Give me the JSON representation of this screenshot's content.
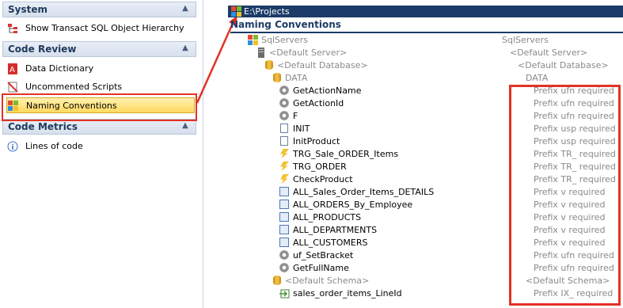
{
  "sidebar": {
    "sections": [
      {
        "title": "System",
        "items": [
          {
            "label": "Show Transact SQL Object Hierarchy",
            "icon": "hierarchy-icon"
          }
        ]
      },
      {
        "title": "Code Review",
        "items": [
          {
            "label": "Data Dictionary",
            "icon": "data-dictionary-icon"
          },
          {
            "label": "Uncommented Scripts",
            "icon": "uncommented-scripts-icon"
          },
          {
            "label": "Naming Conventions",
            "icon": "naming-conventions-icon"
          }
        ]
      },
      {
        "title": "Code Metrics",
        "items": [
          {
            "label": "Lines of code",
            "icon": "info-icon"
          }
        ]
      }
    ],
    "selected": "Naming Conventions"
  },
  "main": {
    "path": "E:\\Projects",
    "heading": "Naming Conventions",
    "tree": [
      {
        "name": "SqlServers",
        "value": "SqlServers"
      },
      {
        "name": "<Default Server>",
        "value": "<Default Server>"
      },
      {
        "name": "<Default Database>",
        "value": "<Default Database>"
      },
      {
        "name": "DATA",
        "value": "DATA"
      },
      {
        "name": "GetActionName",
        "value": "Prefix ufn required"
      },
      {
        "name": "GetActionId",
        "value": "Prefix ufn required"
      },
      {
        "name": "F",
        "value": "Prefix ufn required"
      },
      {
        "name": "INIT",
        "value": "Prefix usp required"
      },
      {
        "name": "InitProduct",
        "value": "Prefix usp required"
      },
      {
        "name": "TRG_Sale_ORDER_Items",
        "value": "Prefix TR_ required"
      },
      {
        "name": "TRG_ORDER",
        "value": "Prefix TR_ required"
      },
      {
        "name": "CheckProduct",
        "value": "Prefix TR_ required"
      },
      {
        "name": "ALL_Sales_Order_Items_DETAILS",
        "value": "Prefix v required"
      },
      {
        "name": "ALL_ORDERS_By_Employee",
        "value": "Prefix v required"
      },
      {
        "name": "ALL_PRODUCTS",
        "value": "Prefix v required"
      },
      {
        "name": "ALL_DEPARTMENTS",
        "value": "Prefix v required"
      },
      {
        "name": "ALL_CUSTOMERS",
        "value": "Prefix v required"
      },
      {
        "name": "uf_SetBracket",
        "value": "Prefix ufn required"
      },
      {
        "name": "GetFullName",
        "value": "Prefix ufn required"
      },
      {
        "name": "<Default Schema>",
        "value": "<Default Schema>"
      },
      {
        "name": "sales_order_items_LineId",
        "value": "Prefix IX_ required"
      }
    ]
  },
  "colors": {
    "highlight": "#e23224",
    "header_bar": "#1c3b68",
    "selected_item": "#ffd95e"
  }
}
